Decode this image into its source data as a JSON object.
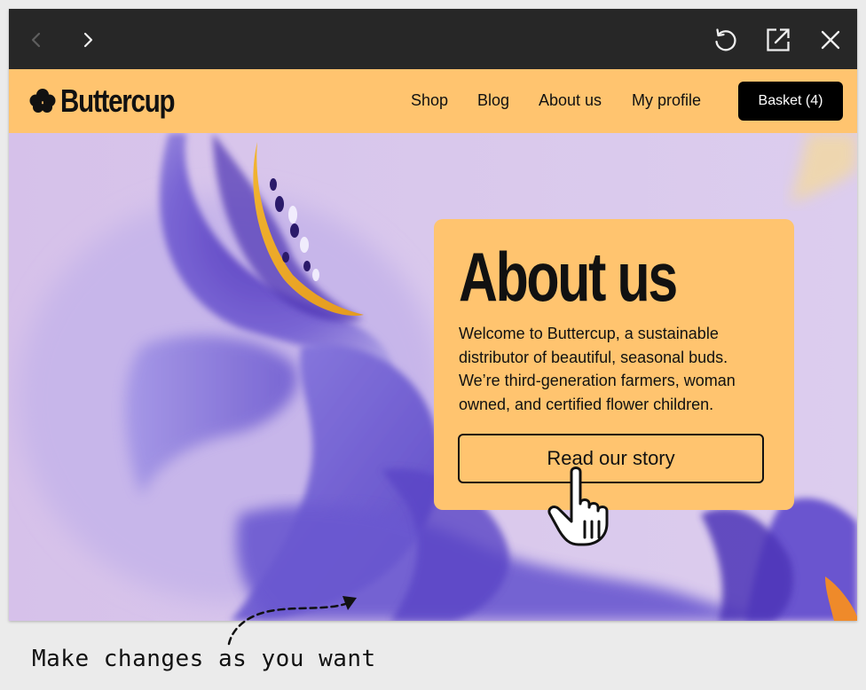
{
  "browser": {
    "back_icon": "chevron-left-icon",
    "forward_icon": "chevron-right-icon",
    "reload_icon": "reload-icon",
    "open_external_icon": "open-external-icon",
    "close_icon": "close-icon"
  },
  "header": {
    "brand": "Buttercup",
    "logo_icon": "clover-icon",
    "nav": [
      {
        "label": "Shop"
      },
      {
        "label": "Blog"
      },
      {
        "label": "About us"
      },
      {
        "label": "My profile"
      }
    ],
    "basket_label": "Basket (4)"
  },
  "hero": {
    "title": "About us",
    "body": "Welcome to Buttercup, a sustainable distributor of beautiful, seasonal buds. We’re third-generation farmers, woman owned, and certified flower children.",
    "button_label": "Read our story"
  },
  "annotation": {
    "text": "Make changes as you want"
  },
  "colors": {
    "header_bg": "#ffc46f",
    "browser_bar": "#272727",
    "basket_bg": "#000000",
    "hero_bg": "#d8c6ea"
  }
}
